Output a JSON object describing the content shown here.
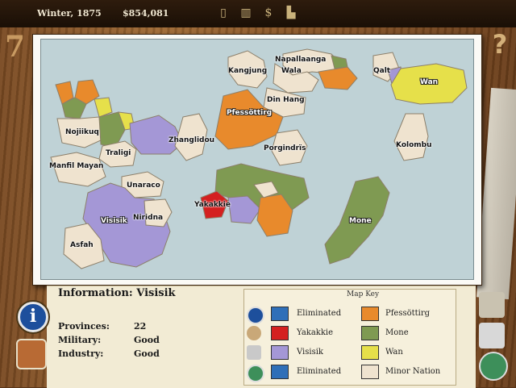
{
  "header": {
    "date": "Winter, 1875",
    "treasury": "$854,081",
    "icons": [
      "ledger-icon",
      "bank-icon",
      "dollar-icon",
      "parliament-icon"
    ]
  },
  "map": {
    "labels": [
      {
        "text": "Napallaanga",
        "style": "dark"
      },
      {
        "text": "Kangjung",
        "style": "dark"
      },
      {
        "text": "Wala",
        "style": "dark"
      },
      {
        "text": "Qalt",
        "style": "dark"
      },
      {
        "text": "Wan",
        "style": "white"
      },
      {
        "text": "Din Hang",
        "style": "dark"
      },
      {
        "text": "Pfessöttirg",
        "style": "white"
      },
      {
        "text": "Nojiikuq",
        "style": "dark"
      },
      {
        "text": "Zhanglidou",
        "style": "dark"
      },
      {
        "text": "Traligi",
        "style": "dark"
      },
      {
        "text": "Porgindrïs",
        "style": "dark"
      },
      {
        "text": "Kolombu",
        "style": "dark"
      },
      {
        "text": "Manfil Mayan",
        "style": "dark"
      },
      {
        "text": "Unaraco",
        "style": "dark"
      },
      {
        "text": "Yakakkie",
        "style": "dark"
      },
      {
        "text": "Visisik",
        "style": "white"
      },
      {
        "text": "Niridna",
        "style": "dark"
      },
      {
        "text": "Mone",
        "style": "white"
      },
      {
        "text": "Asfah",
        "style": "dark"
      }
    ]
  },
  "information": {
    "title_prefix": "Information:",
    "title_name": "Visisik",
    "rows": [
      {
        "label": "Provinces:",
        "value": "22"
      },
      {
        "label": "Military:",
        "value": "Good"
      },
      {
        "label": "Industry:",
        "value": "Good"
      }
    ]
  },
  "map_key": {
    "title": "Map Key",
    "entries": [
      {
        "name": "Eliminated",
        "color": "#2f6fb8"
      },
      {
        "name": "Pfessöttirg",
        "color": "#e88a2c"
      },
      {
        "name": "Yakakkie",
        "color": "#d42020"
      },
      {
        "name": "Mone",
        "color": "#7f9a52"
      },
      {
        "name": "Visisik",
        "color": "#a497d6"
      },
      {
        "name": "Wan",
        "color": "#e6e04a"
      },
      {
        "name": "Eliminated",
        "color": "#2f6fb8"
      },
      {
        "name": "Minor Nation",
        "color": "#efe3cf"
      }
    ]
  },
  "colors": {
    "sea": "#bfd2d6",
    "minor": "#efe3cf",
    "pfessottirg": "#e88a2c",
    "yakakkie": "#d42020",
    "mone": "#7f9a52",
    "visisik": "#a497d6",
    "wan": "#e6e04a"
  }
}
